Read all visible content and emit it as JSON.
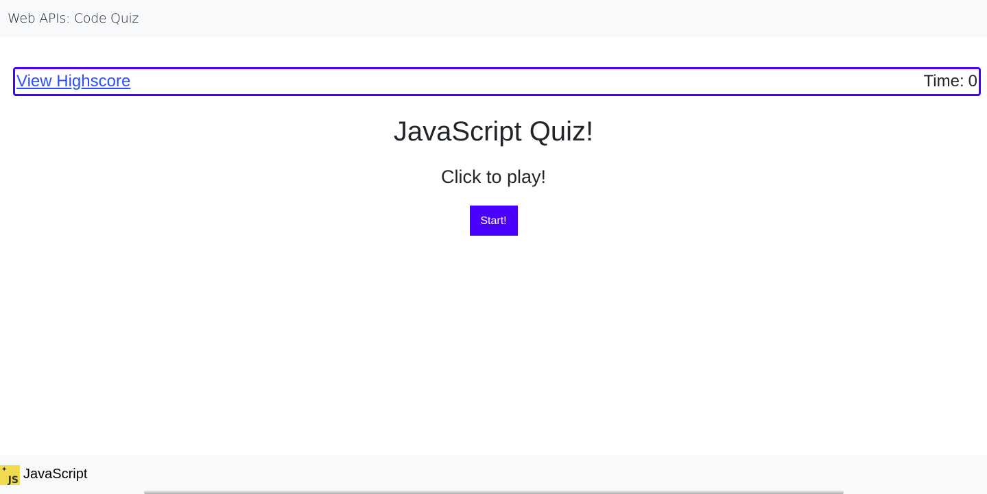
{
  "navbar": {
    "brand": "Web APIs: Code Quiz"
  },
  "header": {
    "highscore_link": "View Highscore",
    "time_label": "Time:",
    "time_value": "0"
  },
  "main": {
    "title": "JavaScript Quiz!",
    "subtitle": "Click to play!",
    "start_button": "Start!"
  },
  "footer": {
    "label": "JavaScript",
    "logo_text": "JS"
  },
  "colors": {
    "accent": "#4b00ff",
    "link": "#2b4fff",
    "bar_background": "#f8f9fa",
    "js_yellow": "#f0db4f"
  }
}
